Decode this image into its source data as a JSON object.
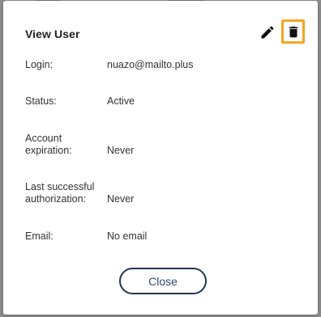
{
  "dialog": {
    "title": "View User",
    "edit_icon": "pencil-icon",
    "delete_icon": "trash-icon",
    "highlight_color": "#f2a623",
    "close_label": "Close"
  },
  "fields": [
    {
      "label": "Login:",
      "value": "nuazo@mailto.plus"
    },
    {
      "label": "Status:",
      "value": "Active"
    },
    {
      "label": "Account\nexpiration:",
      "value": "Never"
    },
    {
      "label": "Last successful\nauthorization:",
      "value": "Never"
    },
    {
      "label": "Email:",
      "value": "No email"
    }
  ]
}
